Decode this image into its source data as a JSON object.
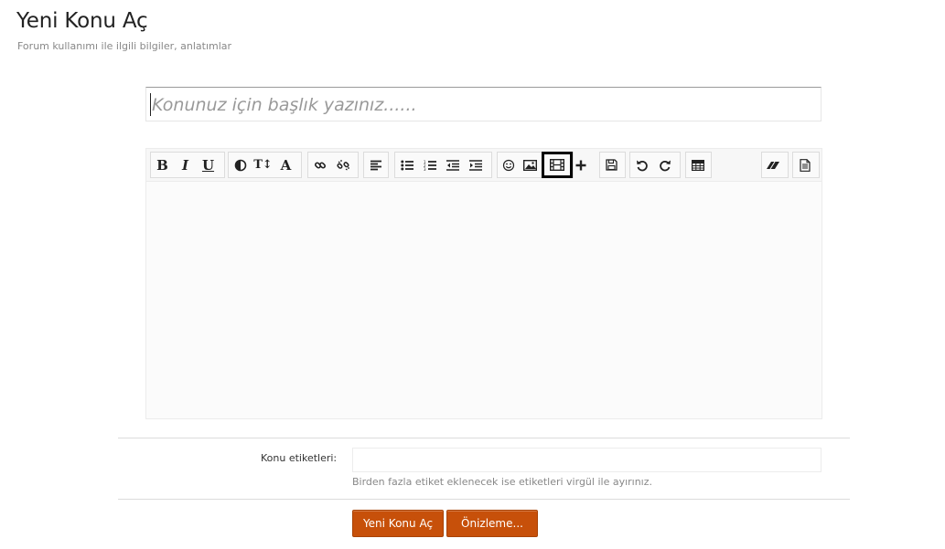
{
  "header": {
    "title": "Yeni Konu Aç",
    "subtitle": "Forum kullanımı ile ilgili bilgiler, anlatımlar"
  },
  "title_field": {
    "placeholder": "Konunuz için başlık yazınız......",
    "value": ""
  },
  "toolbar": {
    "bold": "B",
    "italic": "I",
    "underline": "U",
    "font_size": "T↕",
    "font_family": "A",
    "icons": [
      "bold-icon",
      "italic-icon",
      "underline-icon",
      "text-color-icon",
      "font-size-icon",
      "font-family-icon",
      "link-icon",
      "unlink-icon",
      "align-left-icon",
      "bulleted-list-icon",
      "numbered-list-icon",
      "outdent-icon",
      "indent-icon",
      "smiley-icon",
      "image-icon",
      "media-icon",
      "plus-icon",
      "save-icon",
      "undo-icon",
      "redo-icon",
      "table-icon",
      "eraser-icon",
      "source-icon"
    ]
  },
  "editor": {
    "content": ""
  },
  "tags": {
    "label": "Konu etiketleri:",
    "value": "",
    "hint": "Birden fazla etiket eklenecek ise etiketleri virgül ile ayırınız."
  },
  "actions": {
    "submit_label": "Yeni Konu Aç",
    "preview_label": "Önizleme..."
  },
  "colors": {
    "accent": "#c7500a",
    "highlight_border": "#000000"
  }
}
